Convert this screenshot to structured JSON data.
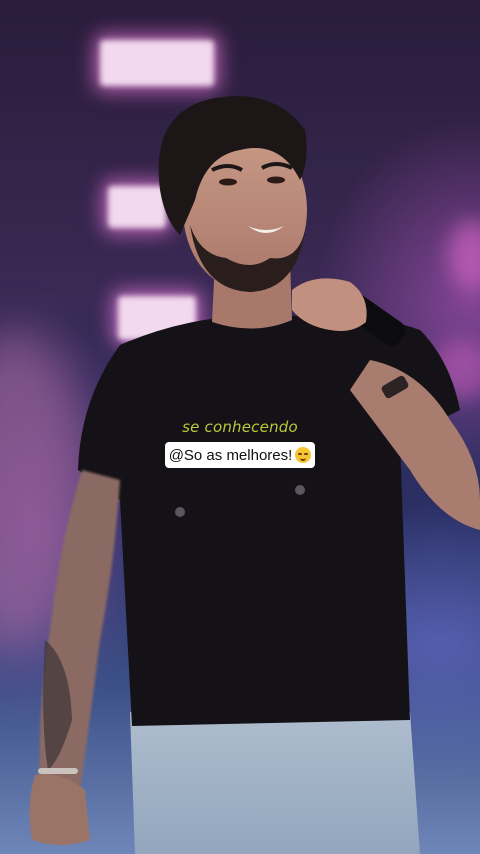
{
  "overlay": {
    "subtitle": "se conhecendo",
    "mention": "@So as melhores!",
    "emoji": "smirking-face"
  }
}
